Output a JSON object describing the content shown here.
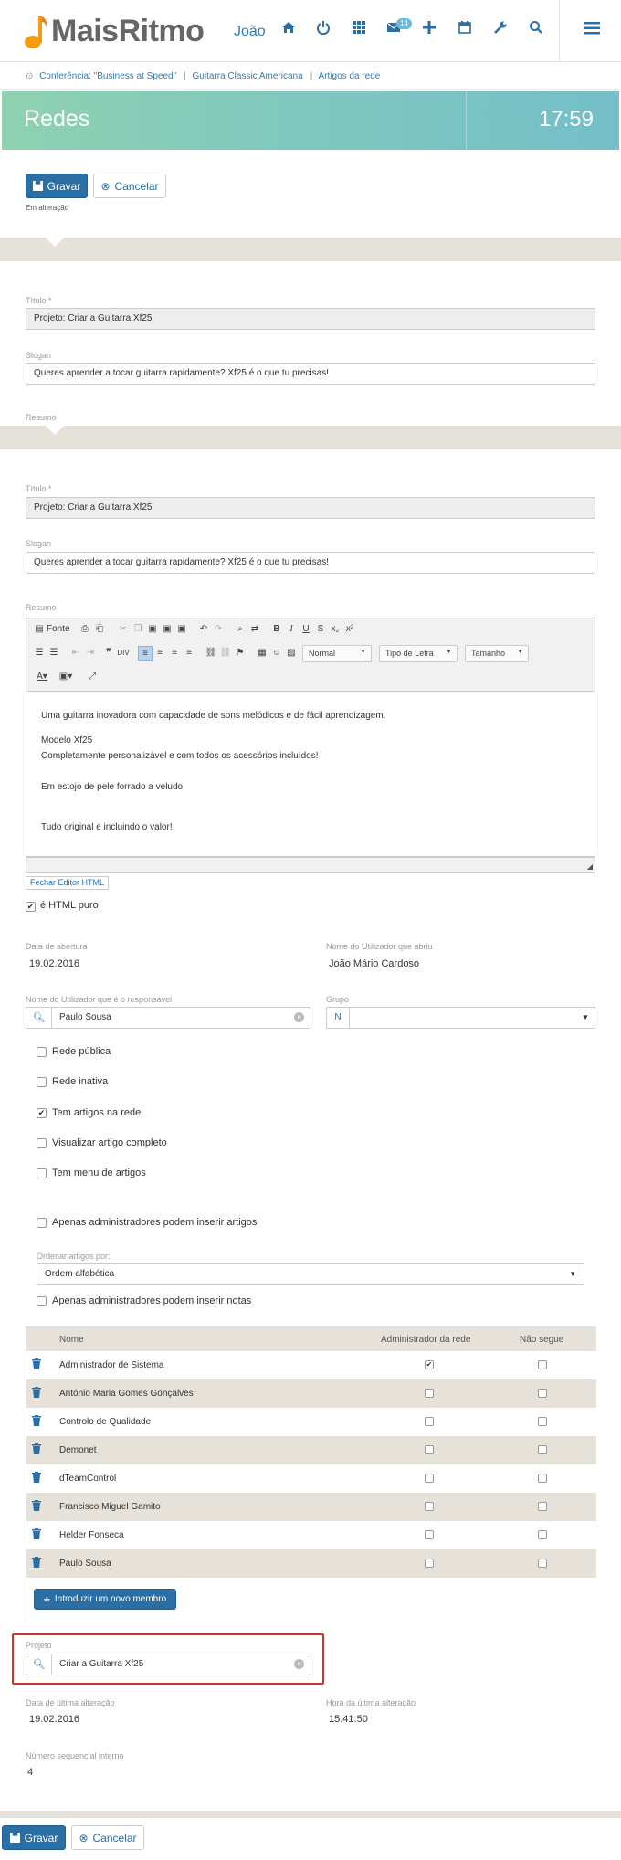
{
  "header": {
    "brand": "MaisRitmo",
    "user": "João",
    "mail_count": "14",
    "icons": [
      "home-icon",
      "power-icon",
      "apps-icon",
      "mail-icon",
      "plus-icon",
      "calendar-icon",
      "wrench-icon",
      "search-icon",
      "menu-icon"
    ]
  },
  "breadcrumb": [
    "Conferência: \"Business at Speed\"",
    "Guitarra Classic Americana",
    "Artigos da rede"
  ],
  "title": {
    "text": "Redes",
    "clock": "17:59"
  },
  "actions": {
    "save": "Gravar",
    "cancel": "Cancelar",
    "status": "Em alteração"
  },
  "summary": {
    "title_label": "Título *",
    "title_value": "Projeto: Criar a Guitarra Xf25",
    "slogan_label": "Slogan",
    "slogan_value": "Queres aprender a tocar guitarra rapidamente? Xf25 é o que tu precisas!",
    "resumo_label": "Resumo"
  },
  "form": {
    "title_label": "Título *",
    "title_value": "Projeto: Criar a Guitarra Xf25",
    "slogan_label": "Slogan",
    "slogan_value": "Queres aprender a tocar guitarra rapidamente? Xf25 é o que tu precisas!",
    "resumo_label": "Resumo",
    "toolbar": {
      "source": "Fonte",
      "format": "Normal",
      "font": "Tipo de Letra",
      "size": "Tamanho"
    },
    "editor_lines": [
      "Uma guitarra inovadora com capacidade de sons melódicos e de fácil aprendizagem.",
      "Modelo Xf25",
      "Completamente personalizável e com todos os acessórios incluídos!",
      "Em estojo de pele forrado a veludo",
      "Tudo original e incluindo o valor!"
    ],
    "close_editor": "Fechar Editor HTML",
    "html_puro": "é HTML puro",
    "opened_date_label": "Data de abertura",
    "opened_date": "19.02.2016",
    "opened_by_label": "Nome do Utilizador que abriu",
    "opened_by": "João Mário Cardoso",
    "responsible_label": "Nome do Utilizador que é o responsável",
    "responsible": "Paulo Sousa",
    "group_label": "Grupo",
    "group_prefix": "N",
    "checks": [
      {
        "label": "Rede pública",
        "checked": false
      },
      {
        "label": "Rede inativa",
        "checked": false
      },
      {
        "label": "Tem artigos na rede",
        "checked": true
      },
      {
        "label": "Visualizar artigo completo",
        "checked": false
      },
      {
        "label": "Tem menu de artigos",
        "checked": false
      }
    ],
    "admins_articles": "Apenas administradores podem inserir artigos",
    "order_label": "Ordenar artigos por:",
    "order_value": "Ordem alfabética",
    "admins_notes": "Apenas administradores podem inserir notas"
  },
  "members": {
    "headers": [
      "Nome",
      "Administrador da rede",
      "Não segue"
    ],
    "rows": [
      {
        "name": "Administrador de Sistema",
        "admin": true,
        "nofollow": false
      },
      {
        "name": "António Maria Gomes Gonçalves",
        "admin": false,
        "nofollow": false
      },
      {
        "name": "Controlo de Qualidade",
        "admin": false,
        "nofollow": false
      },
      {
        "name": "Demonet",
        "admin": false,
        "nofollow": false
      },
      {
        "name": "dTeamControl",
        "admin": false,
        "nofollow": false
      },
      {
        "name": "Francisco Miguel Gamito",
        "admin": false,
        "nofollow": false
      },
      {
        "name": "Helder Fonseca",
        "admin": false,
        "nofollow": false
      },
      {
        "name": "Paulo Sousa",
        "admin": false,
        "nofollow": false
      }
    ],
    "add_button": "Introduzir um novo membro"
  },
  "project": {
    "label": "Projeto",
    "value": "Criar a Guitarra Xf25"
  },
  "meta": {
    "last_date_label": "Data de última alteração",
    "last_date": "19.02.2016",
    "last_time_label": "Hora da última alteração",
    "last_time": "15:41:50",
    "seq_label": "Número sequencial interno",
    "seq": "4"
  },
  "colors": {
    "primary": "#2a6ea6",
    "band": "#e6e2da",
    "highlight": "#c0392b"
  }
}
